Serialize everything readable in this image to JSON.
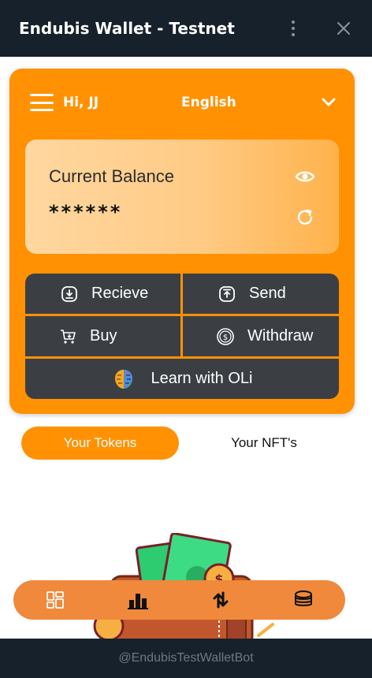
{
  "window": {
    "title": "Endubis Wallet - Testnet",
    "menu_icon": "kebab-menu-icon",
    "close_icon": "close-icon"
  },
  "header": {
    "greeting": "Hi, JJ",
    "language": "English",
    "menu_icon": "hamburger-icon",
    "dropdown_icon": "chevron-down-icon"
  },
  "balance": {
    "label": "Current Balance",
    "masked_value": "******",
    "toggle_icon": "eye-icon",
    "refresh_icon": "refresh-icon"
  },
  "actions": {
    "recieve": "Recieve",
    "send": "Send",
    "buy": "Buy",
    "withdraw": "Withdraw",
    "learn": "Learn with OLi"
  },
  "tabs": {
    "tokens": "Your Tokens",
    "nfts": "Your NFT's",
    "active": "tokens"
  },
  "bottom_nav": [
    {
      "icon": "dashboard-icon"
    },
    {
      "icon": "bar-chart-icon"
    },
    {
      "icon": "swap-arrows-icon"
    },
    {
      "icon": "coins-stack-icon"
    }
  ],
  "footer": {
    "bot_handle": "@EndubisTestWalletBot"
  },
  "colors": {
    "accent": "#ff9103",
    "nav_bar": "#f0893c",
    "dark": "#17212b",
    "button": "#3b3f44"
  }
}
